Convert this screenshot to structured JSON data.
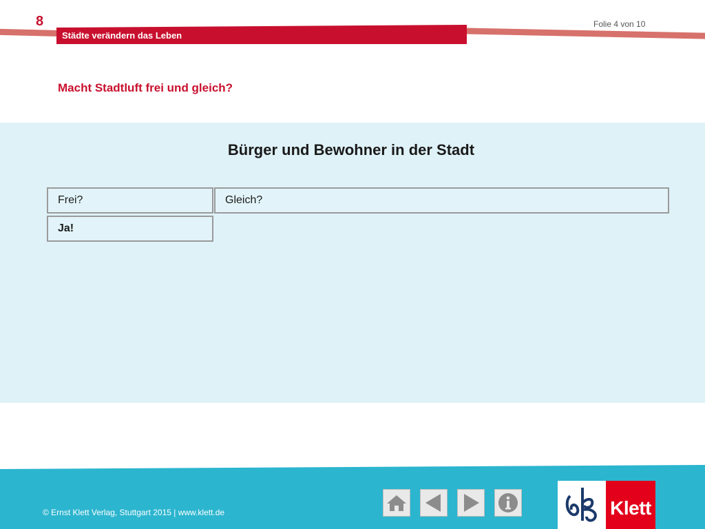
{
  "header": {
    "chapter_number": "8",
    "chapter_title": "Städte verändern das Leben",
    "slide_counter": "Folie 4 von 10",
    "question": "Macht Stadtluft frei und gleich?",
    "accent_color": "#c8102e"
  },
  "content": {
    "heading": "Bürger und Bewohner in der Stadt",
    "panel_color": "#dff2f8",
    "table": {
      "headers": [
        "Frei?",
        "Gleich?"
      ],
      "rows": [
        [
          "Ja!",
          ""
        ]
      ]
    }
  },
  "footer": {
    "copyright": "© Ernst Klett Verlag, Stuttgart 2015 | www.klett.de",
    "band_color": "#2cb5cf",
    "nav_buttons": [
      {
        "icon": "home-icon"
      },
      {
        "icon": "arrow-left-icon"
      },
      {
        "icon": "arrow-right-icon"
      },
      {
        "icon": "info-icon"
      }
    ],
    "logo": {
      "wordmark": "Klett",
      "color": "#e2001a"
    }
  }
}
